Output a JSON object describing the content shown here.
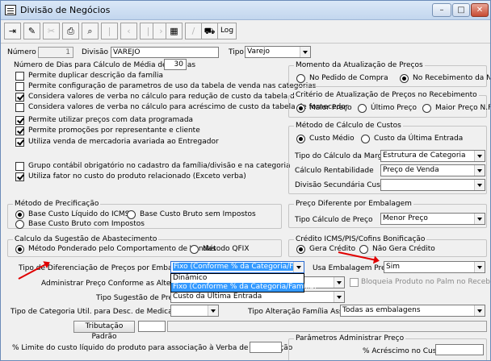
{
  "window": {
    "title": "Divisão de Negócios",
    "min": "–",
    "max": "□",
    "close": "✕"
  },
  "toolbar": {
    "log_label": "Log"
  },
  "header": {
    "numero_label": "Número",
    "numero_value": "1",
    "divisao_label": "Divisão",
    "divisao_value": "VAREJO",
    "tipo_label": "Tipo",
    "tipo_value": "Varejo"
  },
  "left": {
    "dias_label": "Número de Dias para Cálculo de Média de Vendas",
    "dias_value": "30",
    "checks": [
      {
        "label": "Permite duplicar descrição da família",
        "checked": false
      },
      {
        "label": "Permite configuração de parametros de uso da tabela de venda nas categorias",
        "checked": false
      },
      {
        "label": "Considera valores de verba no cálculo para redução de custo da tabela de fornecedor",
        "checked": true
      },
      {
        "label": "Considera valores de verba no cálculo para acréscimo de custo da tabela de fornecedor",
        "checked": false
      },
      {
        "label": "Permite utilizar preços com data programada",
        "checked": true
      },
      {
        "label": "Permite promoções por representante e cliente",
        "checked": true
      },
      {
        "label": "Utiliza venda de mercadoria avariada ao Entregador",
        "checked": true
      },
      {
        "label": "Grupo contábil obrigatório no cadastro da família/divisão e na categoria",
        "checked": false
      },
      {
        "label": "Utiliza fator no custo do produto relacionado (Exceto verba)",
        "checked": true
      }
    ]
  },
  "momento": {
    "title": "Momento da Atualização de Preços",
    "opt1": "No Pedido de Compra",
    "opt2": "No Recebimento da NF"
  },
  "criterio": {
    "title": "Critério de Atualização de Preços no Recebimento",
    "opt1": "Maior Preço",
    "opt2": "Último Preço",
    "opt3": "Maior Preço N.F."
  },
  "metodo_custos": {
    "title": "Método de Cálculo de Custos",
    "opt1": "Custo Médio",
    "opt2": "Custo da Última Entrada",
    "margem_label": "Tipo do Cálculo da Margem",
    "margem_value": "Estrutura de Categoria",
    "rentab_label": "Cálculo Rentabilidade",
    "rentab_value": "Preço de Venda",
    "divsec_label": "Divisão Secundária Custo",
    "divsec_value": ""
  },
  "precificacao": {
    "title": "Método de Precificação",
    "opt1": "Base Custo Líquido do ICMS",
    "opt2": "Base Custo Bruto sem Impostos",
    "opt3": "Base Custo Bruto com Impostos"
  },
  "preco_emb": {
    "title": "Preço Diferente por Embalagem",
    "tipo_label": "Tipo Cálculo de Preço",
    "tipo_value": "Menor Preço"
  },
  "abastec": {
    "title": "Calculo da Sugestão de Abastecimento",
    "opt1": "Método Ponderado pelo Comportamento de Vendas",
    "opt2": "Método QFIX"
  },
  "credito": {
    "title": "Crédito ICMS/PIS/Cofins Bonificação",
    "opt1": "Gera Crédito",
    "opt2": "Não Gera Crédito"
  },
  "bottom": {
    "dif_label": "Tipo de Diferenciação de Preços por Embalagem",
    "dif_value": "Fixo (Conforme % da Categoria/Família)",
    "dif_options": [
      "Dinâmico",
      "Fixo (Conforme % da Categoria/Família)"
    ],
    "usa_emb_label": "Usa Embalagem Preço",
    "usa_emb_value": "Sim",
    "adm_label": "Administrar Preço Conforme as Alterações",
    "bloqueia_label": "Bloqueia Produto no Palm no Receb.",
    "sugestao_label": "Tipo Sugestão de Preço",
    "sugestao_value": "Custo da Última Entrada",
    "categoria_label": "Tipo de Categoria Util. para Desc. de Medicamentos",
    "categoria_value": "",
    "alteracao_label": "Tipo Alteração Família Assoc.",
    "alteracao_value": "Todas as embalagens",
    "tributacao_btn": "Tributação Padrão",
    "limite_label": "% Limite do custo líquido do produto para associação à Verba de Bonificação",
    "param_title": "Parâmetros Administrar Preço",
    "acrescimo_label": "% Acréscimo no Custo"
  },
  "accent": {
    "selection": "#3399ff",
    "annotation": "#e00000"
  }
}
